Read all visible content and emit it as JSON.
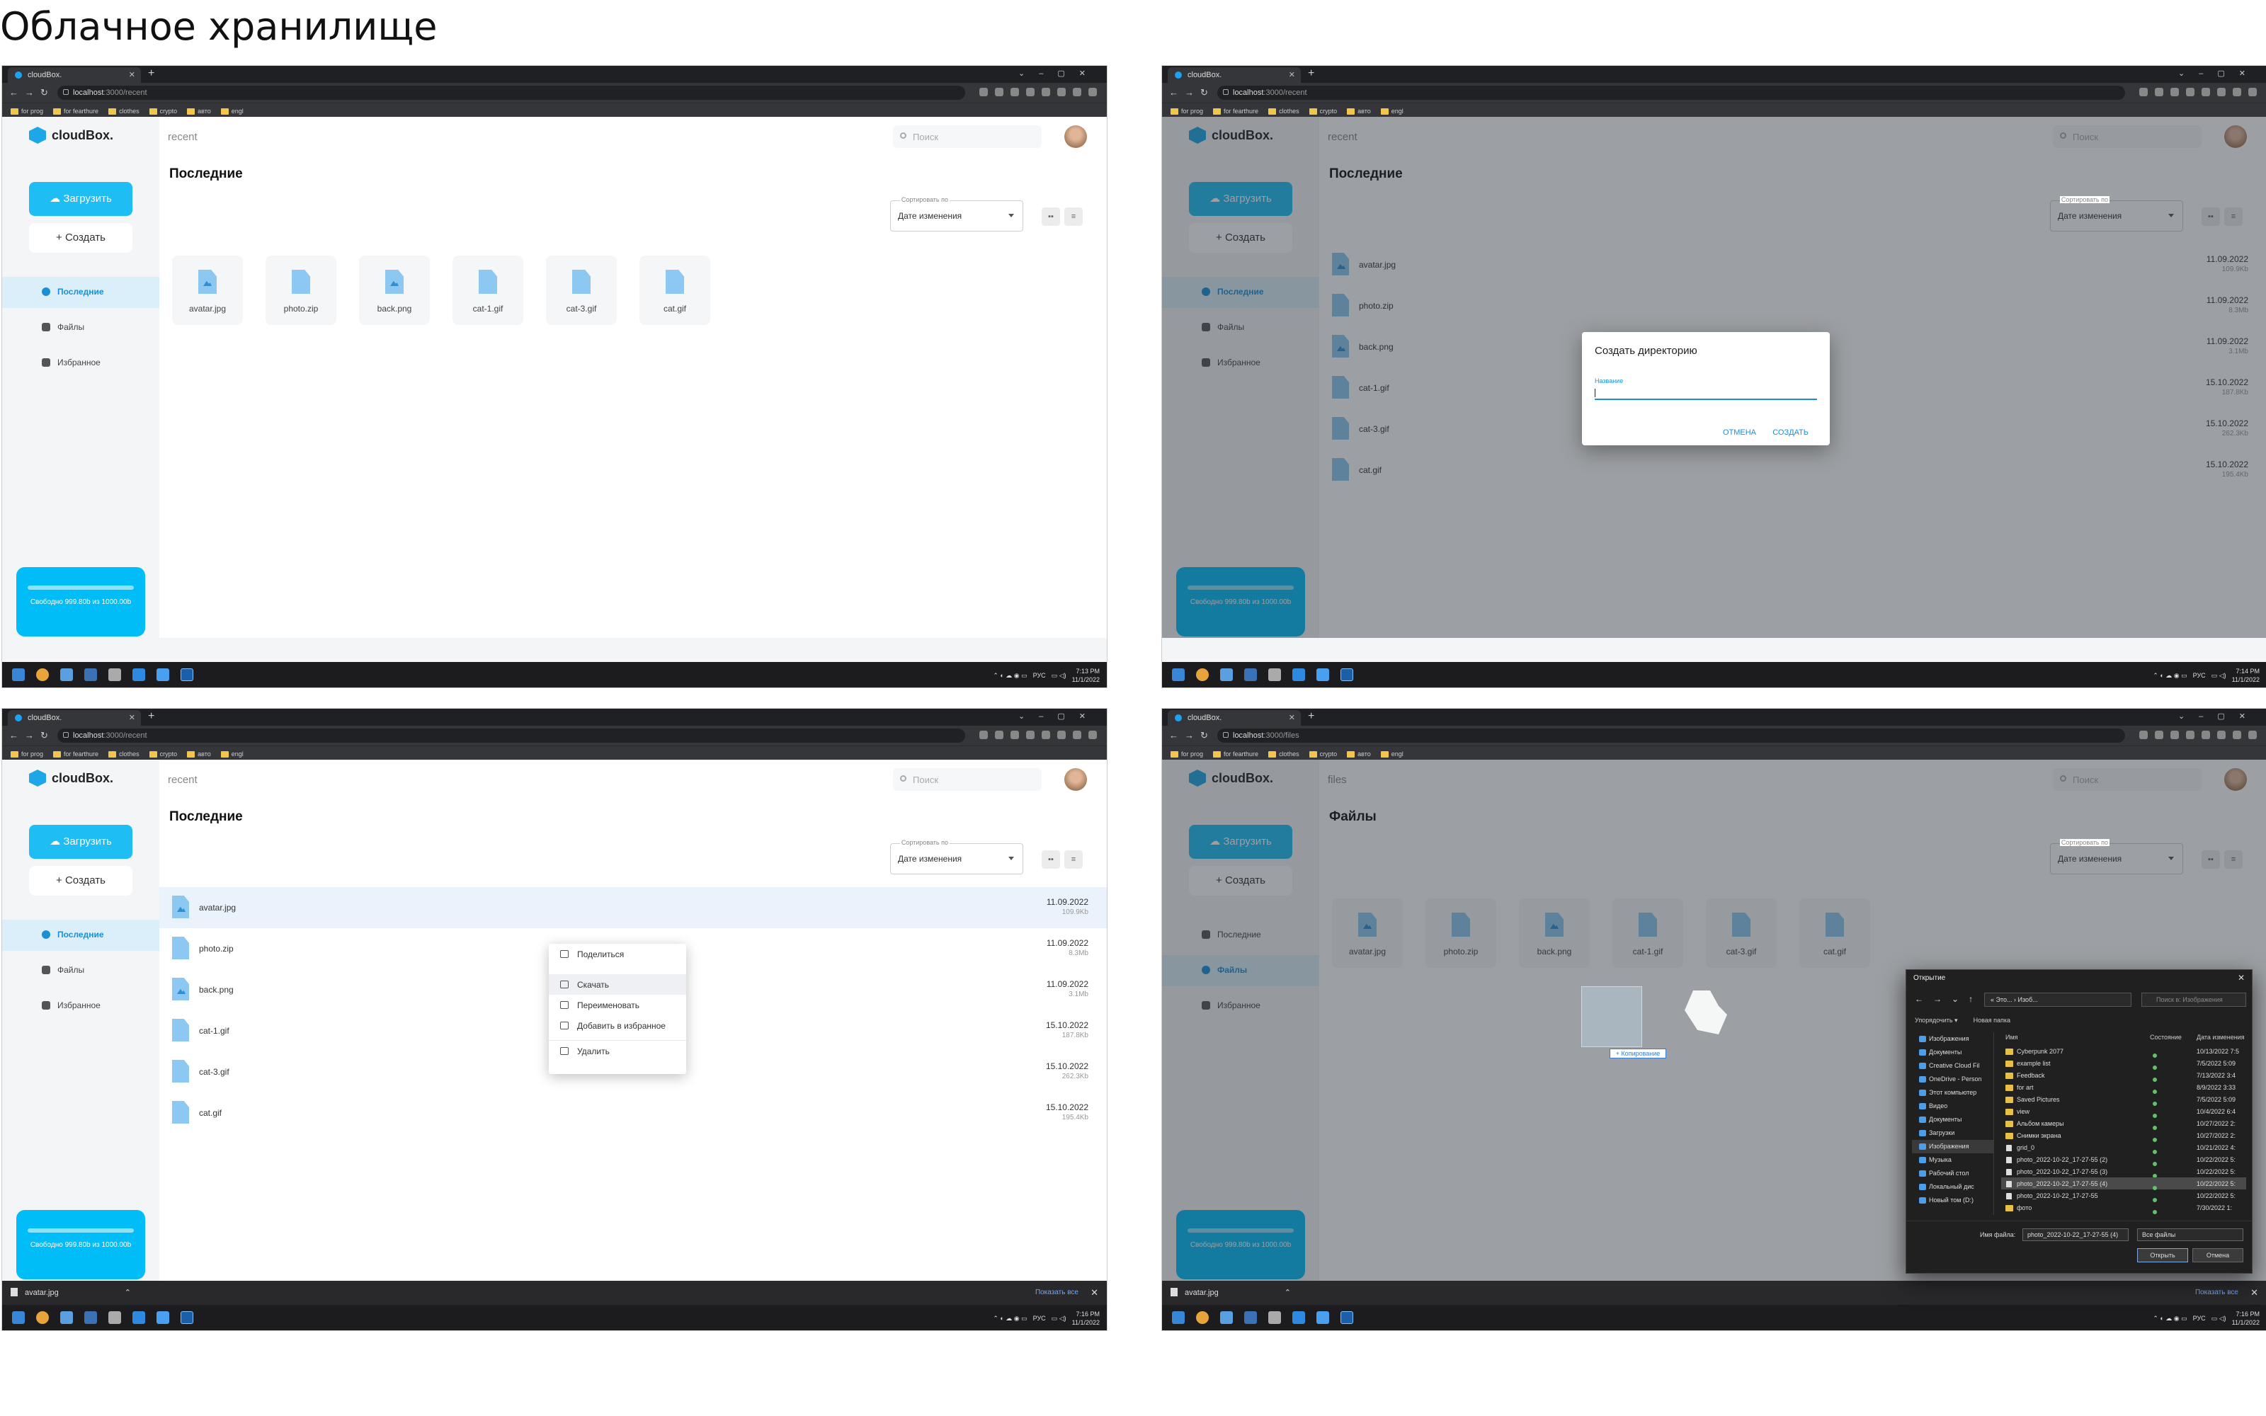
{
  "page_title": "Облачное хранилище",
  "browser": {
    "tab_title": "cloudBox.",
    "bookmarks": [
      "for prog",
      "for fearthure",
      "clothes",
      "crypto",
      "авто",
      "engl"
    ]
  },
  "app": {
    "logo": "cloudBox.",
    "upload_label": "Загрузить",
    "create_label": "Создать",
    "nav": [
      "Последние",
      "Файлы",
      "Избранное"
    ],
    "search_placeholder": "Поиск",
    "sort_label": "Сортировать по",
    "sort_value": "Дате изменения",
    "storage_text": "Свободно 999.80b из 1000.00b"
  },
  "files": [
    {
      "name": "avatar.jpg",
      "type": "img",
      "date": "11.09.2022",
      "size": "109.9Kb"
    },
    {
      "name": "photo.zip",
      "type": "doc",
      "date": "11.09.2022",
      "size": "8.3Mb"
    },
    {
      "name": "back.png",
      "type": "img",
      "date": "11.09.2022",
      "size": "3.1Mb"
    },
    {
      "name": "cat-1.gif",
      "type": "doc",
      "date": "15.10.2022",
      "size": "187.8Kb"
    },
    {
      "name": "cat-3.gif",
      "type": "doc",
      "date": "15.10.2022",
      "size": "262.3Kb"
    },
    {
      "name": "cat.gif",
      "type": "doc",
      "date": "15.10.2022",
      "size": "195.4Kb"
    }
  ],
  "screens": [
    {
      "url_host": "localhost",
      "url_path": ":3000/recent",
      "crumb": "recent",
      "heading": "Последние",
      "time": "7:13 PM",
      "date": "11/1/2022"
    },
    {
      "url_host": "localhost",
      "url_path": ":3000/recent",
      "crumb": "recent",
      "heading": "Последние",
      "time": "7:14 PM",
      "date": "11/1/2022"
    },
    {
      "url_host": "localhost",
      "url_path": ":3000/recent",
      "crumb": "recent",
      "heading": "Последние",
      "time": "7:16 PM",
      "date": "11/1/2022"
    },
    {
      "url_host": "localhost",
      "url_path": ":3000/files",
      "crumb": "files",
      "heading": "Файлы",
      "time": "7:16 PM",
      "date": "11/1/2022"
    }
  ],
  "tray": {
    "lang": "РУС"
  },
  "dialog": {
    "title": "Создать директорию",
    "field_label": "Название",
    "cancel": "ОТМЕНА",
    "create": "СОЗДАТЬ"
  },
  "context_menu": [
    "Поделиться",
    "Скачать",
    "Переименовать",
    "Добавить в избранное",
    "Удалить"
  ],
  "download_bar": {
    "file": "avatar.jpg",
    "show_all": "Показать все"
  },
  "drag": {
    "tag": "+ Копирование"
  },
  "explorer": {
    "title": "Открытие",
    "path": "« Это... › Изоб...",
    "search": "Поиск в: Изображения",
    "toolbar": [
      "Упорядочить ▾",
      "Новая папка"
    ],
    "left": [
      "Изображения",
      "Документы",
      "Creative Cloud Fil",
      "OneDrive - Person",
      "Этот компьютер",
      "Видео",
      "Документы",
      "Загрузки",
      "Изображения",
      "Музыка",
      "Рабочий стол",
      "Локальный дис",
      "Новый том (D:)"
    ],
    "columns": [
      "Имя",
      "Состояние",
      "Дата изменения"
    ],
    "rows": [
      {
        "name": "Cyberpunk 2077",
        "date": "10/13/2022 7:5"
      },
      {
        "name": "example list",
        "date": "7/5/2022 5:09"
      },
      {
        "name": "Feedback",
        "date": "7/13/2022 3:4"
      },
      {
        "name": "for art",
        "date": "8/9/2022 3:33"
      },
      {
        "name": "Saved Pictures",
        "date": "7/5/2022 5:09"
      },
      {
        "name": "view",
        "date": "10/4/2022 6:4"
      },
      {
        "name": "Альбом камеры",
        "date": "10/27/2022 2:"
      },
      {
        "name": "Снимки экрана",
        "date": "10/27/2022 2:"
      },
      {
        "name": "grid_0",
        "date": "10/21/2022 4:"
      },
      {
        "name": "photo_2022-10-22_17-27-55 (2)",
        "date": "10/22/2022 5:"
      },
      {
        "name": "photo_2022-10-22_17-27-55 (3)",
        "date": "10/22/2022 5:"
      },
      {
        "name": "photo_2022-10-22_17-27-55 (4)",
        "date": "10/22/2022 5:"
      },
      {
        "name": "photo_2022-10-22_17-27-55",
        "date": "10/22/2022 5:"
      },
      {
        "name": "фото",
        "date": "7/30/2022 1:"
      }
    ],
    "selected_row": 11,
    "filename_label": "Имя файла:",
    "filename": "photo_2022-10-22_17-27-55 (4)",
    "filetype": "Все файлы",
    "open": "Открыть",
    "cancel": "Отмена"
  }
}
